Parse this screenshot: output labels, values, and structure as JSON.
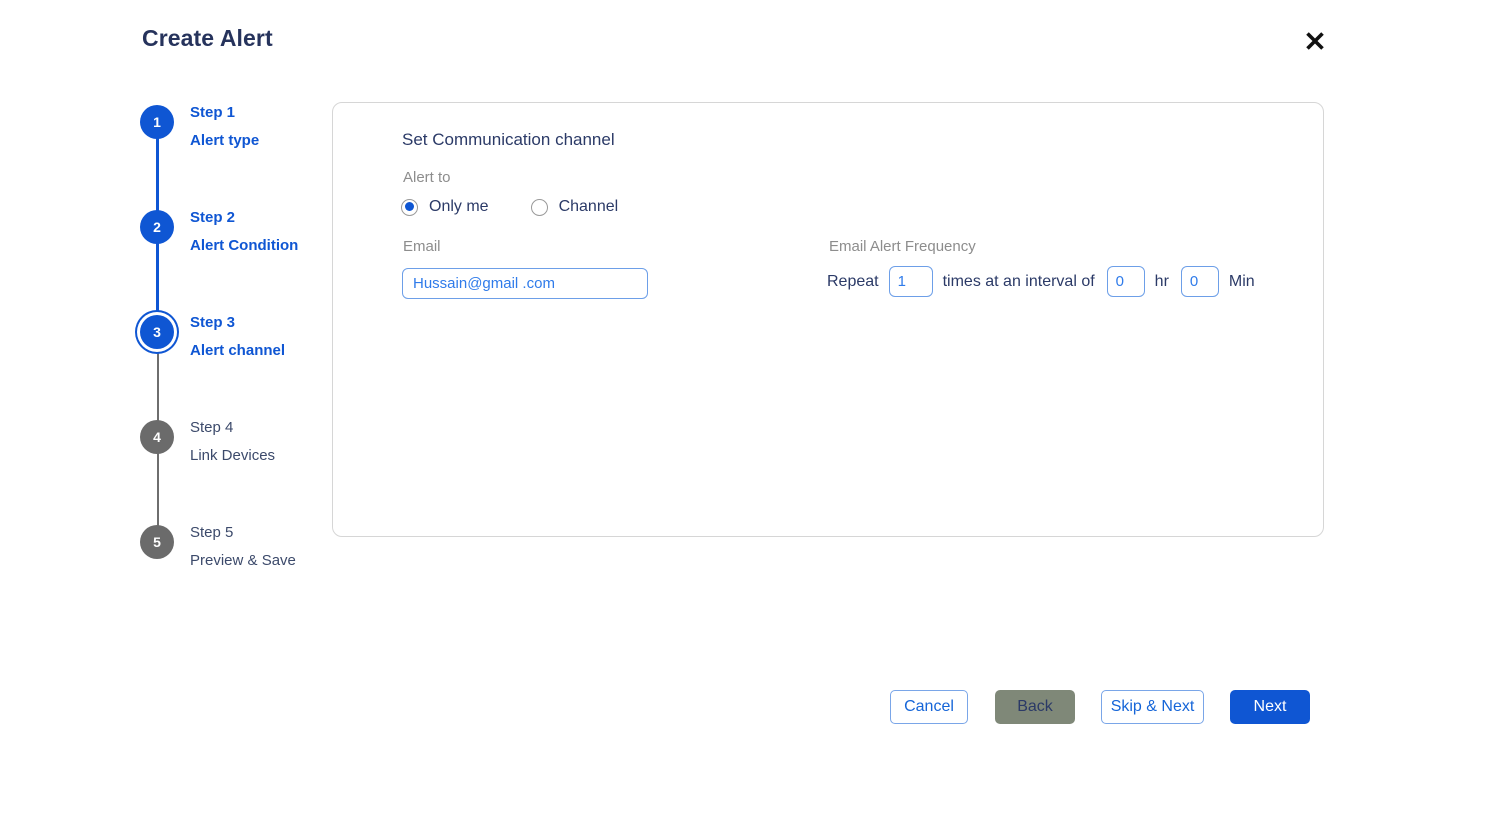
{
  "dialog": {
    "title": "Create Alert",
    "close_icon": "close-x-icon"
  },
  "stepper": {
    "steps": [
      {
        "number": "1",
        "title": "Step 1",
        "sub": "Alert type",
        "state": "complete"
      },
      {
        "number": "2",
        "title": "Step 2",
        "sub": "Alert Condition",
        "state": "complete"
      },
      {
        "number": "3",
        "title": "Step 3",
        "sub": "Alert  channel",
        "state": "active"
      },
      {
        "number": "4",
        "title": "Step 4",
        "sub": "Link Devices",
        "state": "pending"
      },
      {
        "number": "5",
        "title": "Step 5",
        "sub": "Preview & Save",
        "state": "pending"
      }
    ]
  },
  "panel": {
    "heading": "Set Communication channel",
    "alert_to": {
      "label": "Alert to",
      "options": [
        {
          "label": "Only me",
          "selected": true
        },
        {
          "label": "Channel",
          "selected": false
        }
      ]
    },
    "email": {
      "label": "Email",
      "value": "Hussain@gmail .com",
      "placeholder": "Enter email"
    },
    "frequency": {
      "label": "Email Alert Frequency",
      "prefix": "Repeat",
      "repeat_value": "1",
      "middle": "times at an interval of",
      "hr_value": "0",
      "hr_unit": "hr",
      "min_value": "0",
      "min_unit": "Min"
    }
  },
  "footer": {
    "cancel_label": "Cancel",
    "back_label": "Back",
    "skip_next_label": "Skip & Next",
    "next_label": "Next"
  },
  "colors": {
    "accent_blue": "#0f56d3",
    "navy_text": "#2b3a67",
    "muted_gray": "#8d8d8d",
    "back_button_bg": "#7f8878",
    "step_pending": "#6b6b6b",
    "input_border": "#6d9fe8"
  }
}
